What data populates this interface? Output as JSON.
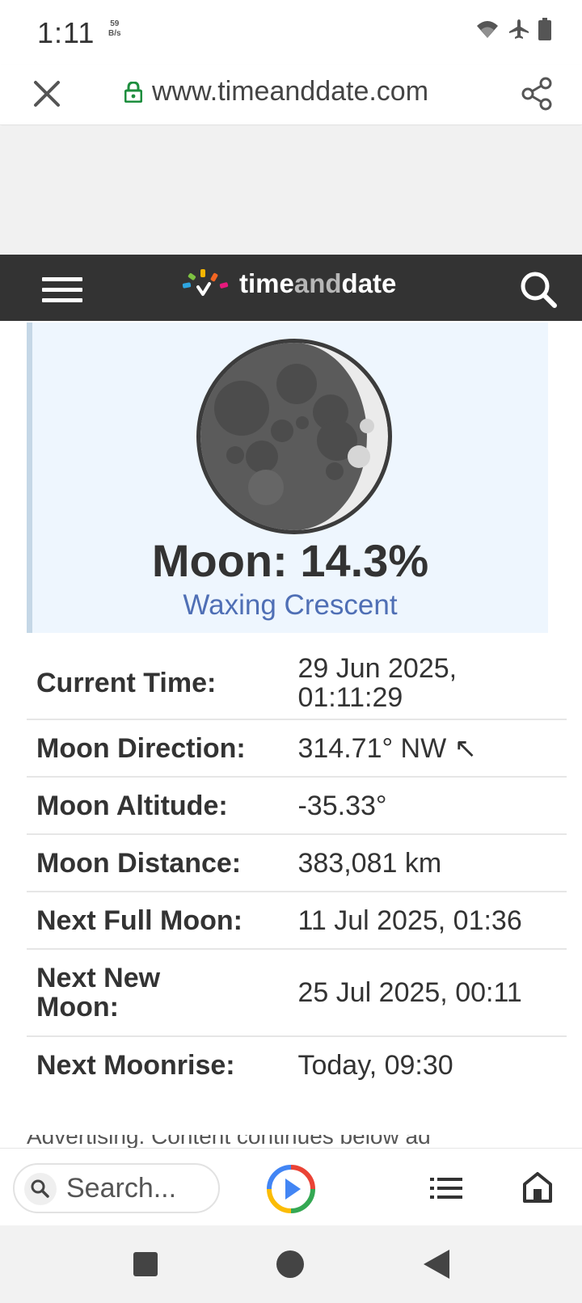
{
  "status_bar": {
    "time": "1:11",
    "net_speed_value": "59",
    "net_speed_unit": "B/s",
    "icons": [
      "wifi-icon",
      "airplane-mode-icon",
      "battery-icon"
    ]
  },
  "browser": {
    "url": "www.timeanddate.com",
    "icons": [
      "close-icon",
      "lock-icon",
      "share-icon"
    ]
  },
  "site_header": {
    "logo_time": "time",
    "logo_and": "and",
    "logo_date": "date",
    "icons": [
      "menu-icon",
      "logo-icon",
      "search-icon"
    ]
  },
  "moon": {
    "illumination_label": "Moon: 14.3%",
    "illumination_value": 14.3,
    "phase": "Waxing Crescent"
  },
  "info_rows": [
    {
      "label": "Current Time:",
      "value": "29 Jun 2025, 01:11:29"
    },
    {
      "label": "Moon Direction:",
      "value": "314.71° NW ↖"
    },
    {
      "label": "Moon Altitude:",
      "value": "-35.33°"
    },
    {
      "label": "Moon Distance:",
      "value": "383,081 km"
    },
    {
      "label": "Next Full Moon:",
      "value": "11 Jul 2025, 01:36"
    },
    {
      "label": "Next New Moon:",
      "value": "25 Jul 2025, 00:11"
    },
    {
      "label": "Next Moonrise:",
      "value": "Today, 09:30"
    }
  ],
  "ad_note": "Advertising: Content continues below ad",
  "bottom_bar": {
    "search_placeholder": "Search...",
    "icons": [
      "search-icon",
      "play-icon",
      "list-icon",
      "home-icon"
    ]
  },
  "android_nav": {
    "icons": [
      "recents-icon",
      "home-circle-icon",
      "back-icon"
    ]
  },
  "colors": {
    "header_bg": "#333333",
    "phase_link": "#4f6fb5",
    "card_bg": "#eef6fe",
    "lock_green": "#1e8e3e"
  }
}
